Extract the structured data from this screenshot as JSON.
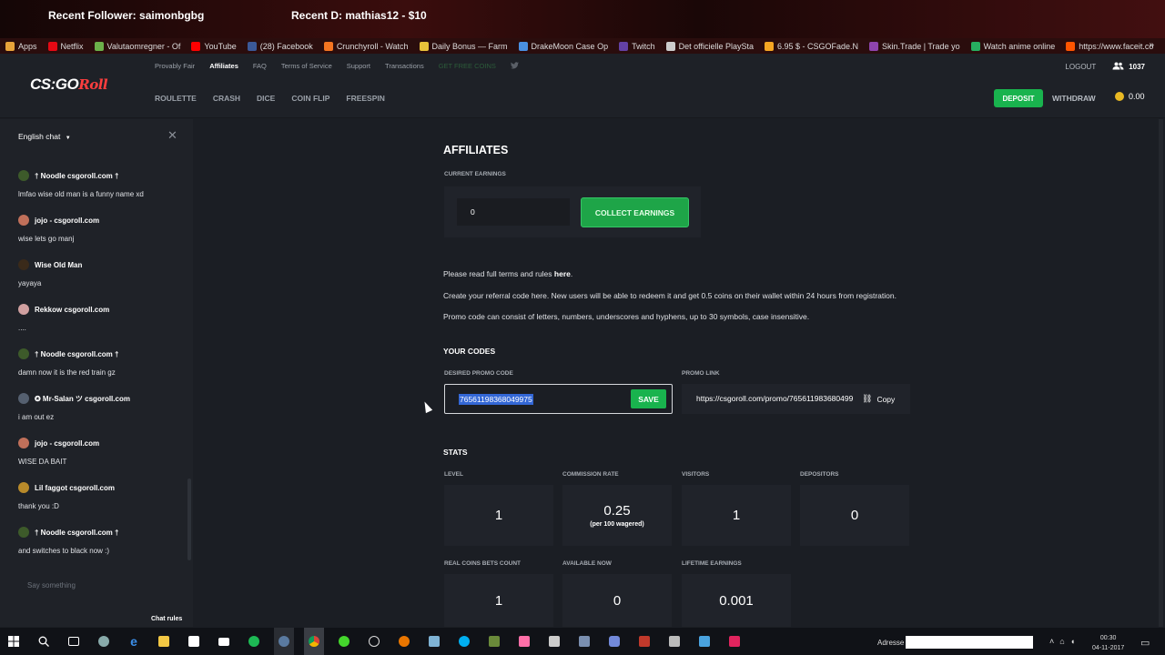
{
  "stream": {
    "recent_follower": "Recent Follower: saimonbgbg",
    "recent_donation": "Recent D: mathias12 - $10"
  },
  "bookmarks": [
    {
      "label": "Apps",
      "color": "#e8a33a"
    },
    {
      "label": "Netflix",
      "color": "#e50914"
    },
    {
      "label": "Valutaomregner - Of",
      "color": "#6bb04a"
    },
    {
      "label": "YouTube",
      "color": "#ff0000"
    },
    {
      "label": "(28) Facebook",
      "color": "#3b5998"
    },
    {
      "label": "Crunchyroll - Watch",
      "color": "#f47521"
    },
    {
      "label": "Daily Bonus — Farm",
      "color": "#e8c23a"
    },
    {
      "label": "DrakeMoon Case Op",
      "color": "#4a90e2"
    },
    {
      "label": "Twitch",
      "color": "#6441a4"
    },
    {
      "label": "Det officielle PlaySta",
      "color": "#cccccc"
    },
    {
      "label": "6.95 $ - CSGOFade.N",
      "color": "#f5a623"
    },
    {
      "label": "Skin.Trade | Trade yo",
      "color": "#8e44ad"
    },
    {
      "label": "Watch anime online",
      "color": "#27ae60"
    },
    {
      "label": "https://www.faceit.co",
      "color": "#ff5500"
    }
  ],
  "bookmarks_more": "»",
  "header": {
    "logo_main": "CS:GO",
    "logo_accent": "Roll",
    "top_nav": [
      "Provably Fair",
      "Affiliates",
      "FAQ",
      "Terms of Service",
      "Support",
      "Transactions",
      "GET FREE COINS"
    ],
    "active_top": "Affiliates",
    "twitter_icon": "twitter-icon",
    "game_nav": [
      "ROULETTE",
      "CRASH",
      "DICE",
      "COIN FLIP",
      "FREESPIN"
    ],
    "logout": "LOGOUT",
    "online_count": "1037",
    "deposit": "DEPOSIT",
    "withdraw": "WITHDRAW",
    "balance": "0.00"
  },
  "chat": {
    "language": "English chat",
    "close": "✕",
    "messages": [
      {
        "name": "† Noodle csgoroll.com †",
        "text": "lmfao wise old man is a funny name xd",
        "avatar_color": "#3d5a2a"
      },
      {
        "name": "jojo - csgoroll.com",
        "text": "wise lets go manj",
        "avatar_color": "#c0705a"
      },
      {
        "name": "Wise Old Man",
        "text": "yayaya",
        "avatar_color": "#3a2a1a"
      },
      {
        "name": "Rekkow csgoroll.com",
        "text": "....",
        "avatar_color": "#d0a0a0"
      },
      {
        "name": "† Noodle csgoroll.com †",
        "text": "damn now it is the red train gz",
        "avatar_color": "#3d5a2a"
      },
      {
        "name": "✪ Mr-Salan ツ csgoroll.com",
        "text": "i am out ez",
        "avatar_color": "#556070"
      },
      {
        "name": "jojo - csgoroll.com",
        "text": "WISE DA BAIT",
        "avatar_color": "#c0705a"
      },
      {
        "name": "Lil faggot csgoroll.com",
        "text": "thank you :D",
        "avatar_color": "#b88a2a"
      },
      {
        "name": "† Noodle csgoroll.com †",
        "text": "and switches to black now :)",
        "avatar_color": "#3d5a2a"
      }
    ],
    "placeholder": "Say something",
    "rules": "Chat rules"
  },
  "affiliates": {
    "title": "AFFILIATES",
    "current_earnings_label": "CURRENT EARNINGS",
    "current_earnings_value": "0",
    "collect_button": "COLLECT EARNINGS",
    "terms_prefix": "Please read full terms and rules ",
    "terms_link": "here",
    "terms_suffix": ".",
    "info_1": "Create your referral code here. New users will be able to redeem it and get 0.5 coins on their wallet within 24 hours from registration.",
    "info_2": "Promo code can consist of letters, numbers, underscores and hyphens, up to 30 symbols, case insensitive.",
    "your_codes": "YOUR CODES",
    "desired_promo_label": "DESIRED PROMO CODE",
    "desired_promo_value": "76561198368049975",
    "save_button": "SAVE",
    "promo_link_label": "PROMO LINK",
    "promo_link_value": "https://csgoroll.com/promo/76561198368049975",
    "copy_button": "Copy",
    "stats_title": "STATS",
    "stats": [
      {
        "label": "LEVEL",
        "value": "1"
      },
      {
        "label": "COMMISSION RATE",
        "value": "0.25",
        "sub": "(per 100 wagered)"
      },
      {
        "label": "VISITORS",
        "value": "1"
      },
      {
        "label": "DEPOSITORS",
        "value": "0"
      },
      {
        "label": "REAL COINS BETS COUNT",
        "value": "1"
      },
      {
        "label": "AVAILABLE NOW",
        "value": "0"
      },
      {
        "label": "LIFETIME EARNINGS",
        "value": "0.001"
      }
    ]
  },
  "taskbar": {
    "address_label": "Adresse",
    "time": "00:30",
    "date": "04-11-2017"
  }
}
